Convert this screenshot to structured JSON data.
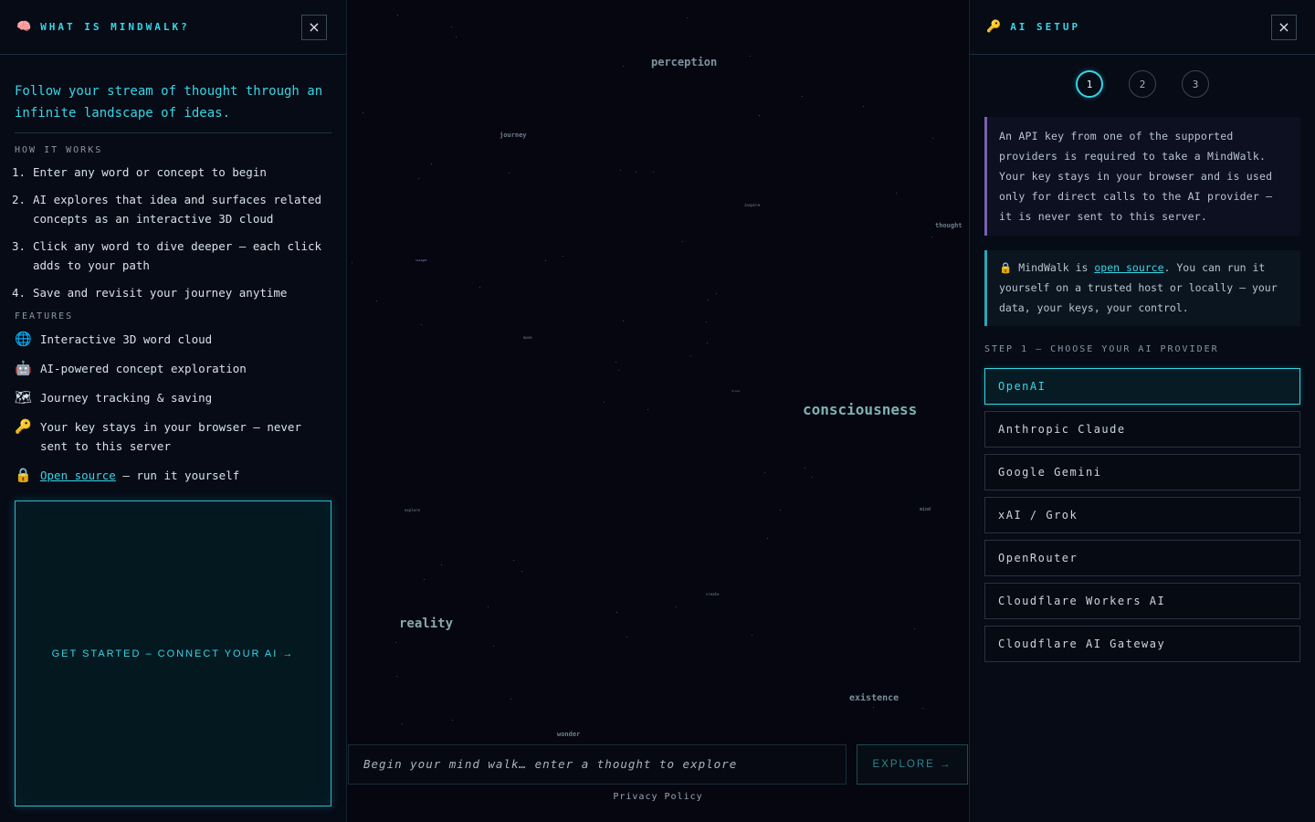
{
  "left_panel": {
    "icon": "brain-icon",
    "title": "WHAT IS MINDWALK?",
    "close": "×",
    "tagline": "Follow your stream of thought through an infinite landscape of ideas.",
    "how_label": "HOW IT WORKS",
    "steps": [
      {
        "num": "1.",
        "text": "Enter any word or concept to begin"
      },
      {
        "num": "2.",
        "text": "AI explores that idea and surfaces related concepts as an interactive 3D cloud"
      },
      {
        "num": "3.",
        "text": "Click any word to dive deeper – each click adds to your path"
      },
      {
        "num": "4.",
        "text": "Save and revisit your journey anytime"
      }
    ],
    "features_label": "FEATURES",
    "features": [
      {
        "icon": "globe-icon",
        "text": "Interactive 3D word cloud"
      },
      {
        "icon": "robot-icon",
        "text": "AI-powered concept exploration"
      },
      {
        "icon": "map-icon",
        "text": "Journey tracking & saving"
      },
      {
        "icon": "key-icon",
        "text": "Your key stays in your browser – never sent to this server"
      },
      {
        "icon": "lock-icon",
        "link": "Open source",
        "text": " – run it yourself"
      }
    ],
    "cta": "GET STARTED – CONNECT YOUR AI →"
  },
  "canvas": {
    "words": [
      "perception",
      "journey",
      "inspire",
      "thought",
      "muse",
      "consciousness",
      "explore",
      "mind",
      "create",
      "reality",
      "existence",
      "wonder",
      "dream",
      "insight"
    ],
    "search_placeholder": "Begin your mind walk… enter a thought to explore",
    "explore_label": "EXPLORE →",
    "privacy": "Privacy Policy"
  },
  "right_panel": {
    "icon": "key-icon",
    "title": "AI SETUP",
    "close": "×",
    "steps": [
      "1",
      "2",
      "3"
    ],
    "active_step": 1,
    "info": "An API key from one of the supported providers is required to take a MindWalk. Your key stays in your browser and is used only for direct calls to the AI provider – it is never sent to this server.",
    "oss_pre": "MindWalk is ",
    "oss_link": "open source",
    "oss_post": ". You can run it yourself on a trusted host or locally – your data, your keys, your control.",
    "step_label": "STEP 1 – CHOOSE YOUR AI PROVIDER",
    "providers": [
      "OpenAI",
      "Anthropic Claude",
      "Google Gemini",
      "xAI / Grok",
      "OpenRouter",
      "Cloudflare Workers AI",
      "Cloudflare AI Gateway"
    ],
    "selected_provider": "OpenAI"
  },
  "colors": {
    "accent": "#36d6e6",
    "background": "#05060f",
    "info_border": "#7d5fb0"
  }
}
